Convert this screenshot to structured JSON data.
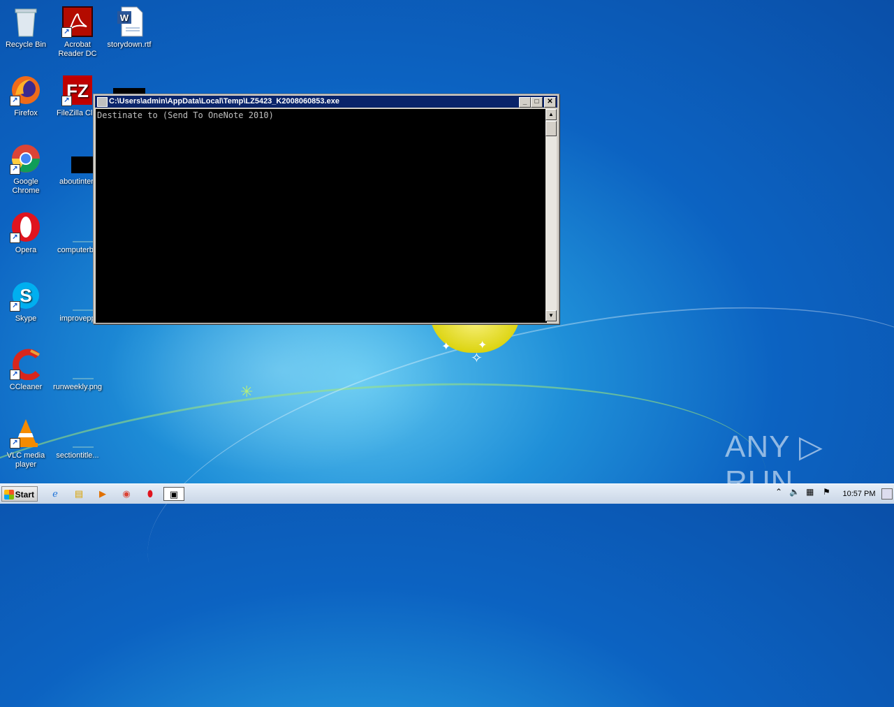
{
  "desktop": {
    "icons": [
      {
        "label": "Recycle Bin"
      },
      {
        "label": "Acrobat Reader DC"
      },
      {
        "label": "storydown.rtf"
      },
      {
        "label": "Firefox"
      },
      {
        "label": "FileZilla Clie"
      },
      {
        "label": "Google Chrome"
      },
      {
        "label": "aboutinterf"
      },
      {
        "label": "Opera"
      },
      {
        "label": "computerbo"
      },
      {
        "label": "Skype"
      },
      {
        "label": "improvepp"
      },
      {
        "label": "CCleaner"
      },
      {
        "label": "runweekly.png"
      },
      {
        "label": "VLC media player"
      },
      {
        "label": "sectiontitle..."
      }
    ]
  },
  "console_window": {
    "title": "C:\\Users\\admin\\AppData\\Local\\Temp\\LZ5423_K2008060853.exe",
    "output": "Destinate to (Send To OneNote 2010)",
    "minimize": "_",
    "maximize": "□",
    "close": "✕"
  },
  "taskbar": {
    "start_label": "Start",
    "clock": "10:57 PM"
  },
  "watermark": "ANY ▷ RUN"
}
